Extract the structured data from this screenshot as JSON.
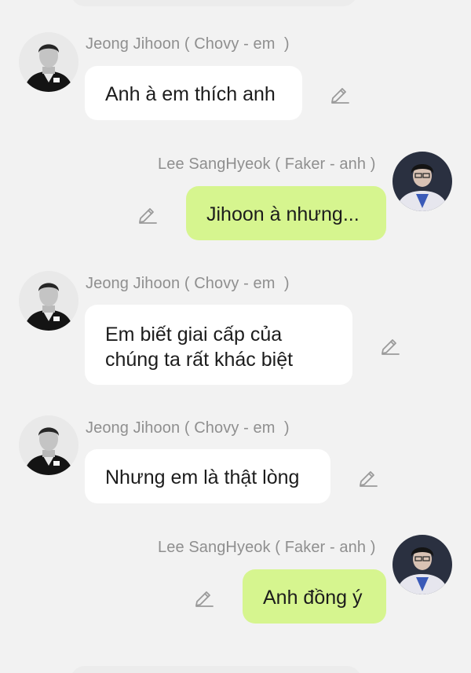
{
  "messages": [
    {
      "sender": "Jeong Jihoon ( Chovy - em  )",
      "direction": "incoming",
      "lines": [
        "Anh à em thích anh"
      ]
    },
    {
      "sender": "Lee SangHyeok ( Faker - anh )",
      "direction": "outgoing",
      "lines": [
        "Jihoon à nhưng..."
      ]
    },
    {
      "sender": "Jeong Jihoon ( Chovy - em  )",
      "direction": "incoming",
      "lines": [
        "Em biết giai cấp của",
        "chúng ta rất khác biệt"
      ]
    },
    {
      "sender": "Jeong Jihoon ( Chovy - em  )",
      "direction": "incoming",
      "lines": [
        "Nhưng em là thật lòng"
      ]
    },
    {
      "sender": "Lee SangHyeok ( Faker - anh )",
      "direction": "outgoing",
      "lines": [
        "Anh đồng ý"
      ]
    }
  ],
  "icons": {
    "edit": "pencil-edit-icon",
    "avatar_incoming": "chovy-avatar",
    "avatar_outgoing": "faker-avatar"
  },
  "colors": {
    "background": "#f2f2f2",
    "incoming_bubble": "#ffffff",
    "outgoing_bubble": "#d6f58f",
    "sender_text": "#8f8f8f",
    "message_text": "#1c1c1c",
    "icon": "#9a9a9a"
  }
}
